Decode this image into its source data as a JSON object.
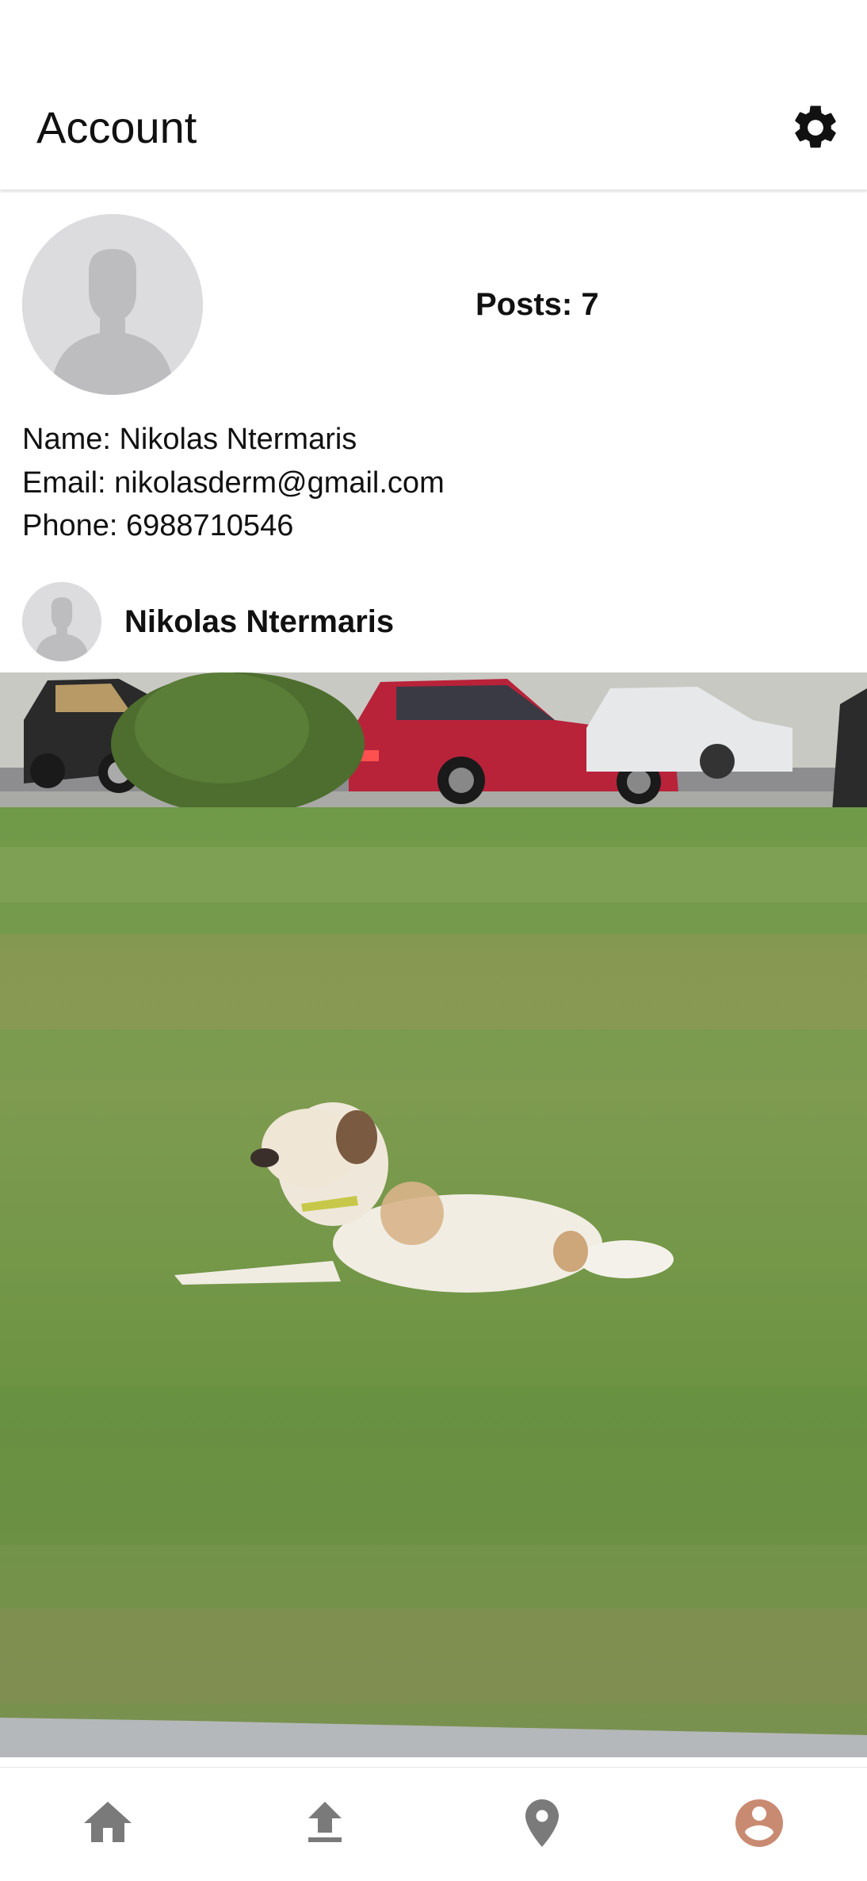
{
  "appbar": {
    "title": "Account",
    "settings_icon": "gear-icon"
  },
  "profile": {
    "avatar_icon": "default-avatar-icon",
    "posts_text": "Posts: 7",
    "name_line": "Name: Nikolas Ntermaris",
    "email_line": "Email: nikolasderm@gmail.com",
    "phone_line": "Phone: 6988710546"
  },
  "post": {
    "author": "Nikolas Ntermaris",
    "avatar_icon": "default-avatar-icon"
  },
  "bottom_nav": {
    "items": [
      {
        "icon": "home-icon",
        "active": false
      },
      {
        "icon": "upload-icon",
        "active": false
      },
      {
        "icon": "map-pin-icon",
        "active": false
      },
      {
        "icon": "account-icon",
        "active": true
      }
    ],
    "inactive_color": "#7a7a7a",
    "active_color": "#c98a72"
  }
}
